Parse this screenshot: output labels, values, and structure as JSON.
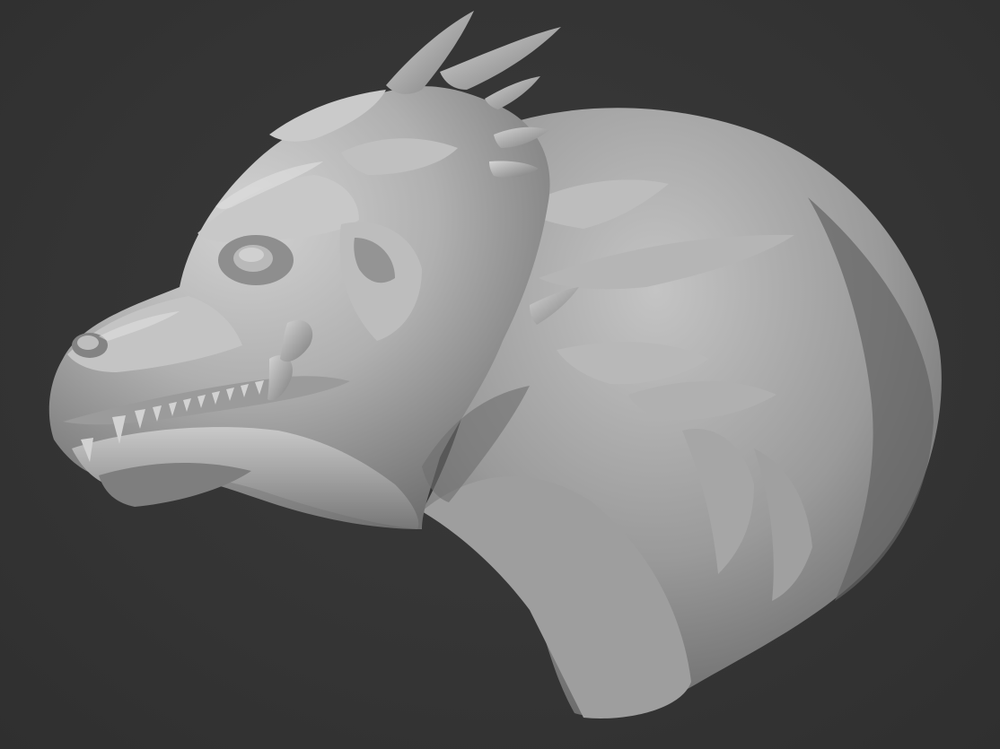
{
  "viewport": {
    "background_color": "#353535",
    "model_base_color": "#a9a9a9",
    "model_highlight_color": "#cfcfcf",
    "model_shadow_color": "#5a5a5a",
    "subject_icon": "dragon-head-sculpt"
  }
}
